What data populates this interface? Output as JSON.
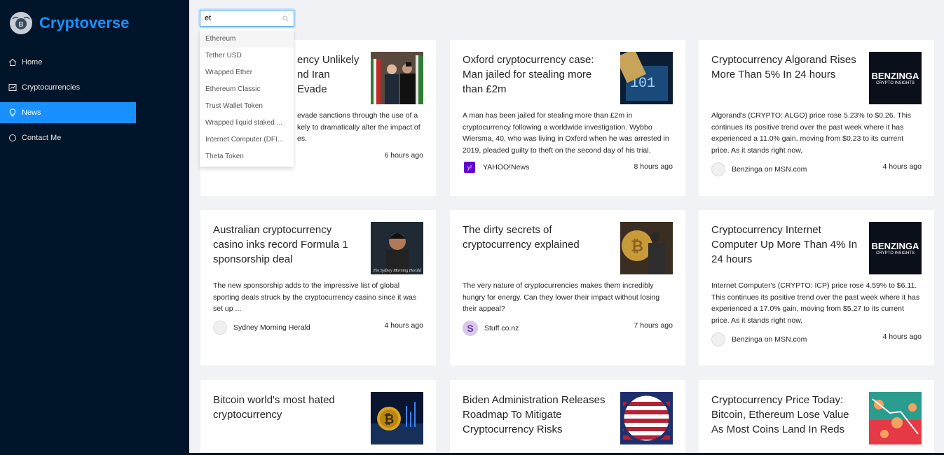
{
  "app": {
    "title": "Cryptoverse",
    "logo_icon": "crypto-coin-icon"
  },
  "nav": [
    {
      "label": "Home",
      "icon": "home-icon",
      "active": false
    },
    {
      "label": "Cryptocurrencies",
      "icon": "fund-icon",
      "active": false
    },
    {
      "label": "News",
      "icon": "bulb-icon",
      "active": true
    },
    {
      "label": "Contact Me",
      "icon": "circle-icon",
      "active": false
    }
  ],
  "search": {
    "value": "et",
    "icon": "search-icon"
  },
  "dropdown": [
    "Ethereum",
    "Tether USD",
    "Wrapped Ether",
    "Ethereum Classic",
    "Trust Wallet Token",
    "Wrapped liquid staked ...",
    "Internet Computer (DFI...",
    "Theta Token"
  ],
  "cards": [
    {
      "title": "...ency Unlikely ...nd Iran Evade",
      "title_visible": "ency Unlikely\nnd Iran Evade",
      "desc": "evade sanctions through the use of a\nkely to dramatically alter the impact of\nes.",
      "provider": "",
      "time": "6 hours ago"
    },
    {
      "title": "Oxford cryptocurrency case: Man jailed for stealing more than £2m",
      "desc": "A man has been jailed for stealing more than £2m in cryptocurrency following a worldwide investigation. Wybbo Wiersma, 40, who was living in Oxford when he was arrested in 2019, pleaded guilty to theft on the second day of his trial.",
      "provider": "YAHOO!News",
      "time": "8 hours ago"
    },
    {
      "title": "Cryptocurrency Algorand Rises More Than 5% In 24 hours",
      "desc": "Algorand's (CRYPTO: ALGO) price rose 5.23% to $0.26. This continues its positive trend over the past week where it has experienced a 11.0% gain, moving from $0.23 to its current price. As it stands right now,",
      "provider": "Benzinga on MSN.com",
      "time": "4 hours ago",
      "img_text": [
        "BENZINGA",
        "CRYPTO INSIGHTS"
      ]
    },
    {
      "title": "Australian cryptocurrency casino inks record Formula 1 sponsorship deal",
      "desc": "The new sponsorship adds to the impressive list of global sporting deals struck by the cryptocurrency casino since it was set up ...",
      "provider": "Sydney Morning Herald",
      "time": "4 hours ago",
      "img_text": [
        "The Sydney Morning Herald"
      ]
    },
    {
      "title": "The dirty secrets of cryptocurrency explained",
      "desc": "The very nature of cryptocurrencies makes them incredibly hungry for energy. Can they lower their impact without losing their appeal?",
      "provider": "Stuff.co.nz",
      "time": "7 hours ago"
    },
    {
      "title": "Cryptocurrency Internet Computer Up More Than 4% In 24 hours",
      "desc": "Internet Computer's (CRYPTO: ICP) price rose 4.59% to $6.11. This continues its positive trend over the past week where it has experienced a 17.0% gain, moving from $5.27 to its current price. As it stands right now,",
      "provider": "Benzinga on MSN.com",
      "time": "4 hours ago",
      "img_text": [
        "BENZINGA",
        "CRYPTO INSIGHTS"
      ]
    },
    {
      "title": "Bitcoin world's most hated cryptocurrency",
      "desc": "",
      "provider": "",
      "time": ""
    },
    {
      "title": "Biden Administration Releases Roadmap To Mitigate Cryptocurrency Risks",
      "desc": "",
      "provider": "",
      "time": ""
    },
    {
      "title": "Cryptocurrency Price Today: Bitcoin, Ethereum Lose Value As Most Coins Land In Reds",
      "desc": "",
      "provider": "",
      "time": ""
    }
  ]
}
